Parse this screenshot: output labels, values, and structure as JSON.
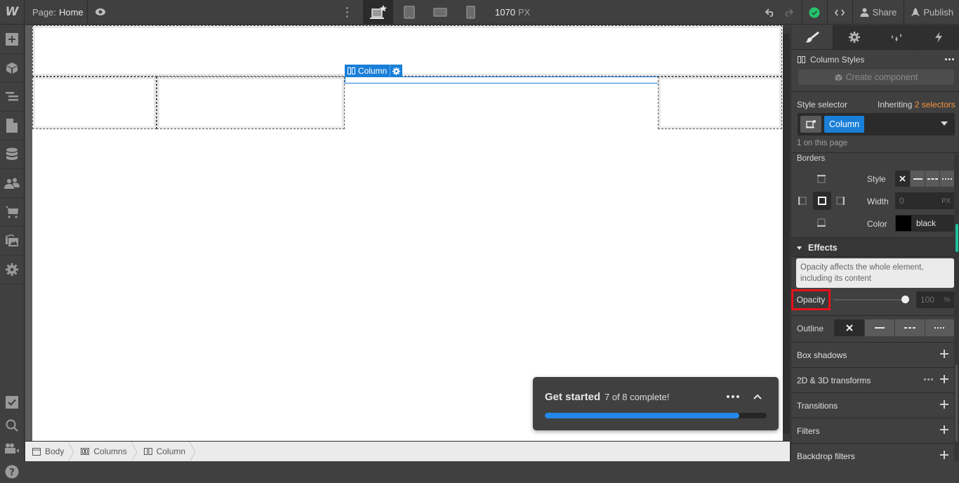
{
  "topbar": {
    "logo": "W",
    "page_label": "Page:",
    "page_name": "Home",
    "preview_icon": "eye-icon",
    "devices": [
      {
        "name": "desktop",
        "icon": "desktop-star-icon",
        "active": true
      },
      {
        "name": "tablet",
        "icon": "tablet-icon",
        "active": false
      },
      {
        "name": "mobile-landscape",
        "icon": "mobile-landscape-icon",
        "active": false
      },
      {
        "name": "mobile-portrait",
        "icon": "mobile-portrait-icon",
        "active": false
      }
    ],
    "canvas_width": "1070",
    "canvas_width_unit": "PX",
    "share_label": "Share",
    "publish_label": "Publish"
  },
  "leftbar": {
    "items": [
      {
        "name": "add",
        "icon": "plus-icon"
      },
      {
        "name": "symbols",
        "icon": "cube-icon"
      },
      {
        "name": "navigator",
        "icon": "navigator-icon"
      },
      {
        "name": "pages",
        "icon": "page-icon"
      },
      {
        "name": "cms",
        "icon": "database-icon"
      },
      {
        "name": "users",
        "icon": "users-icon"
      },
      {
        "name": "ecommerce",
        "icon": "cart-icon"
      },
      {
        "name": "assets",
        "icon": "images-icon"
      },
      {
        "name": "settings",
        "icon": "gear-icon"
      }
    ],
    "bottom_items": [
      {
        "name": "audit",
        "icon": "checkbox-icon"
      },
      {
        "name": "search",
        "icon": "search-icon"
      },
      {
        "name": "tutorials",
        "icon": "video-icon"
      },
      {
        "name": "help",
        "icon": "help-icon"
      }
    ]
  },
  "canvas": {
    "selected_element_label": "Column"
  },
  "breadcrumb": [
    {
      "label": "Body",
      "icon": "body-icon"
    },
    {
      "label": "Columns",
      "icon": "columns-icon"
    },
    {
      "label": "Column",
      "icon": "column-icon"
    }
  ],
  "get_started": {
    "title": "Get started",
    "status": "7 of 8 complete!",
    "progress_fraction": 0.875
  },
  "panel": {
    "tabs": [
      {
        "name": "style",
        "icon": "brush-icon",
        "active": true
      },
      {
        "name": "settings",
        "icon": "gear-icon",
        "active": false
      },
      {
        "name": "style-manager",
        "icon": "drops-icon",
        "active": false
      },
      {
        "name": "interactions",
        "icon": "bolt-icon",
        "active": false
      }
    ],
    "element_styles_title": "Column Styles",
    "create_component_label": "Create component",
    "style_selector_label": "Style selector",
    "inheriting_label": "Inheriting",
    "inheriting_count": "2 selectors",
    "selector_chip": "Column",
    "on_this_page": "1 on this page",
    "borders": {
      "heading": "Borders",
      "style_label": "Style",
      "width_label": "Width",
      "width_value": "0",
      "width_unit": "PX",
      "color_label": "Color",
      "color_value": "black",
      "color_swatch": "#000000"
    },
    "effects": {
      "heading": "Effects",
      "tooltip": "Opacity affects the whole element, including its content",
      "opacity_label": "Opacity",
      "opacity_value": "100",
      "opacity_unit": "%",
      "outline_label": "Outline"
    },
    "sections": [
      {
        "label": "Box shadows",
        "has_more": false
      },
      {
        "label": "2D & 3D transforms",
        "has_more": true
      },
      {
        "label": "Transitions",
        "has_more": false
      },
      {
        "label": "Filters",
        "has_more": false
      },
      {
        "label": "Backdrop filters",
        "has_more": false
      }
    ]
  },
  "colors": {
    "accent": "#1a7fd8",
    "success": "#27c26c",
    "highlight": "#e8121b",
    "orange_text": "#f5913a",
    "progress": "#2388e8"
  }
}
